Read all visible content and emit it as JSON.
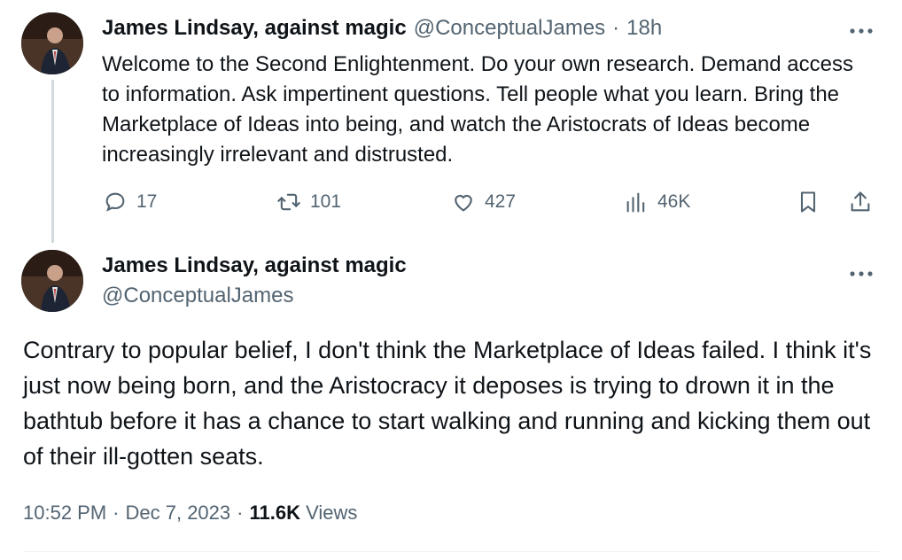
{
  "reply": {
    "display_name": "James Lindsay, against magic",
    "handle": "@ConceptualJames",
    "separator": "·",
    "time": "18h",
    "text": "Welcome to the Second Enlightenment. Do your own research. Demand access to information. Ask impertinent questions. Tell people what you learn. Bring the Marketplace of Ideas into being, and watch the Aristocrats of Ideas become increasingly irrelevant and distrusted.",
    "actions": {
      "replies": "17",
      "reposts": "101",
      "likes": "427",
      "views": "46K"
    },
    "icons": {
      "more": "more-horizontal-icon",
      "reply": "reply-bubble-icon",
      "repost": "repost-icon",
      "like": "heart-icon",
      "views": "views-chart-icon",
      "bookmark": "bookmark-icon",
      "share": "share-icon"
    }
  },
  "main": {
    "display_name": "James Lindsay, against magic",
    "handle": "@ConceptualJames",
    "text": "Contrary to popular belief, I don't think the Marketplace of Ideas failed. I think it's just now being born, and the Aristocracy it deposes is trying to drown it in the bathtub before it has a chance to start walking and running and kicking them out of their ill-gotten seats.",
    "time": "10:52 PM",
    "date": "Dec 7, 2023",
    "separator": "·",
    "views_count": "11.6K",
    "views_label": "Views"
  },
  "colors": {
    "text_primary": "#0f1419",
    "text_secondary": "#536471",
    "thread_line": "#cfd9de"
  }
}
